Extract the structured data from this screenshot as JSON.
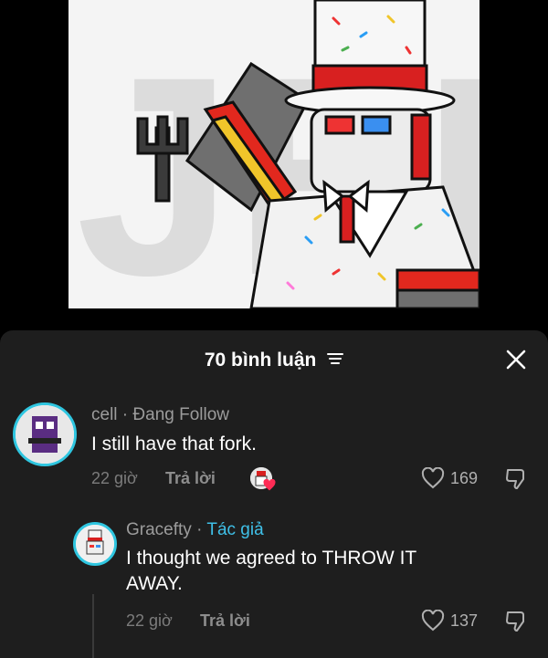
{
  "video": {
    "art_text": "JERX"
  },
  "comments_sheet": {
    "title": "70 bình luận",
    "sort_icon": "filter-lines-icon",
    "close_icon": "close-icon"
  },
  "comments": [
    {
      "author": "cell",
      "separator": "·",
      "status": "Đang Follow",
      "text": "I still have that fork.",
      "time": "22 giờ",
      "reply_label": "Trả lời",
      "creator_liked": true,
      "likes": "169"
    }
  ],
  "replies": [
    {
      "author": "Gracefty",
      "separator": "·",
      "tag": "Tác giả",
      "text_line1": "I thought we agreed to THROW IT",
      "text_line2": "AWAY.",
      "time": "22 giờ",
      "reply_label": "Trả lời",
      "likes": "137"
    }
  ],
  "colors": {
    "sheet_bg": "#1e1e1e",
    "avatar_ring": "#2fc6e0",
    "author_tag": "#3fc0e8"
  }
}
